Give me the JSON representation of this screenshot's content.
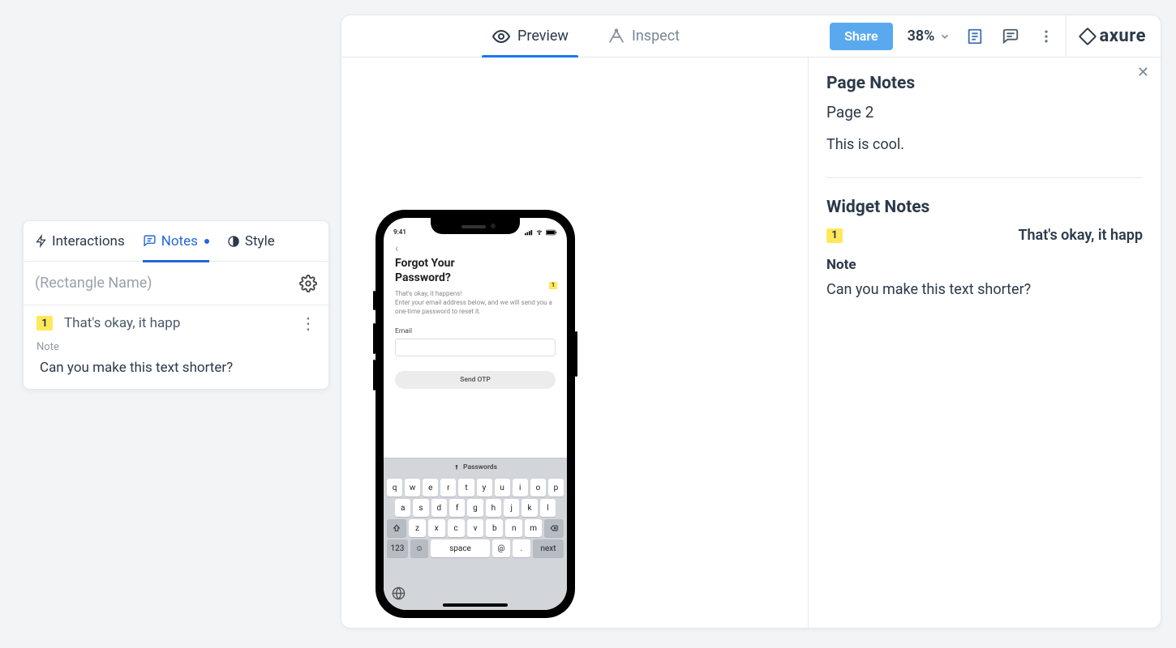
{
  "topbar": {
    "tabs": {
      "preview": "Preview",
      "inspect": "Inspect"
    },
    "active_tab": "preview",
    "share_label": "Share",
    "zoom": "38%",
    "logo_text": "axure"
  },
  "right_panel": {
    "page_notes_heading": "Page Notes",
    "page_name": "Page 2",
    "page_note_body": "This is cool.",
    "widget_notes_heading": "Widget Notes",
    "widget_badge": "1",
    "widget_name": "That's okay, it happ",
    "note_label": "Note",
    "note_body": "Can you make this text shorter?"
  },
  "inspector": {
    "tabs": {
      "interactions": "Interactions",
      "notes": "Notes",
      "style": "Style"
    },
    "active_tab": "notes",
    "name_placeholder": "(Rectangle Name)",
    "item": {
      "badge": "1",
      "title": "That's okay, it happ",
      "kind_label": "Note",
      "text": "Can you make this text shorter?"
    }
  },
  "phone": {
    "time": "9:41",
    "title_line1": "Forgot Your",
    "title_line2": "Password?",
    "desc": "That's okay, it happens!\nEnter your email address below, and we will send you a one-time password to reset it.",
    "badge": "1",
    "email_label": "Email",
    "button_label": "Send OTP",
    "kb_suggestion": "Passwords",
    "keys_r1": [
      "q",
      "w",
      "e",
      "r",
      "t",
      "y",
      "u",
      "i",
      "o",
      "p"
    ],
    "keys_r2": [
      "a",
      "s",
      "d",
      "f",
      "g",
      "h",
      "j",
      "k",
      "l"
    ],
    "keys_r3": [
      "z",
      "x",
      "c",
      "v",
      "b",
      "n",
      "m"
    ],
    "key_123": "123",
    "key_space": "space",
    "key_at": "@",
    "key_dot": ".",
    "key_next": "next"
  }
}
